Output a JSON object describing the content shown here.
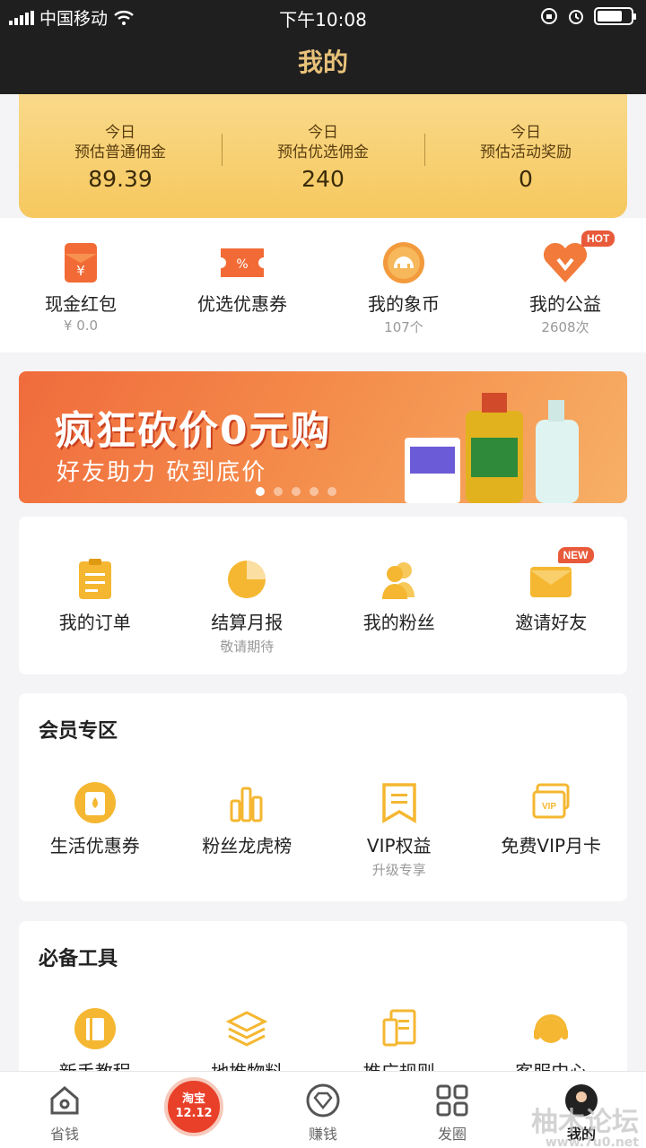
{
  "status": {
    "carrier": "中国移动",
    "time": "下午10:08",
    "battery_level": 0.75
  },
  "header": {
    "title": "我的"
  },
  "stats": [
    {
      "line1": "今日",
      "line2": "预估普通佣金",
      "value": "89.39"
    },
    {
      "line1": "今日",
      "line2": "预估优选佣金",
      "value": "240"
    },
    {
      "line1": "今日",
      "line2": "预估活动奖励",
      "value": "0"
    }
  ],
  "quick": [
    {
      "label": "现金红包",
      "sub": "¥ 0.0",
      "icon": "red-envelope-icon"
    },
    {
      "label": "优选优惠券",
      "sub": "",
      "icon": "coupon-icon"
    },
    {
      "label": "我的象币",
      "sub": "107个",
      "icon": "elephant-coin-icon"
    },
    {
      "label": "我的公益",
      "sub": "2608次",
      "icon": "heart-charity-icon",
      "badge": "HOT"
    }
  ],
  "banner": {
    "headline": "疯狂砍价0元购",
    "subline": "好友助力 砍到底价",
    "active_dot": 0,
    "dot_count": 5
  },
  "orders": [
    {
      "label": "我的订单",
      "sub": "",
      "icon": "order-list-icon"
    },
    {
      "label": "结算月报",
      "sub": "敬请期待",
      "icon": "pie-chart-icon"
    },
    {
      "label": "我的粉丝",
      "sub": "",
      "icon": "fans-icon"
    },
    {
      "label": "邀请好友",
      "sub": "",
      "icon": "envelope-icon",
      "badge": "NEW"
    }
  ],
  "members": {
    "title": "会员专区",
    "items": [
      {
        "label": "生活优惠券",
        "sub": "",
        "icon": "life-coupon-icon"
      },
      {
        "label": "粉丝龙虎榜",
        "sub": "",
        "icon": "bar-ranking-icon"
      },
      {
        "label": "VIP权益",
        "sub": "升级专享",
        "icon": "vip-flag-icon"
      },
      {
        "label": "免费VIP月卡",
        "sub": "",
        "icon": "vip-card-icon"
      }
    ]
  },
  "tools": {
    "title": "必备工具",
    "items": [
      {
        "label": "新手教程",
        "icon": "book-icon"
      },
      {
        "label": "地推物料",
        "icon": "layers-icon"
      },
      {
        "label": "推广规则",
        "icon": "rules-doc-icon"
      },
      {
        "label": "客服中心",
        "icon": "headset-icon"
      }
    ]
  },
  "tabs": [
    {
      "label": "省钱",
      "icon": "home-icon"
    },
    {
      "label": "淘宝\n12.12",
      "icon": "taobao-1212-icon"
    },
    {
      "label": "赚钱",
      "icon": "diamond-icon"
    },
    {
      "label": "发圈",
      "icon": "grid-icon"
    },
    {
      "label": "我的",
      "icon": "avatar-icon"
    }
  ],
  "watermark": {
    "text": "柚木论坛",
    "url": "www.7u0.net"
  },
  "colors": {
    "accent": "#f6c85e",
    "dark": "#1f1f1f",
    "orange": "#f07a3a",
    "gold_icon": "#f5b731"
  }
}
